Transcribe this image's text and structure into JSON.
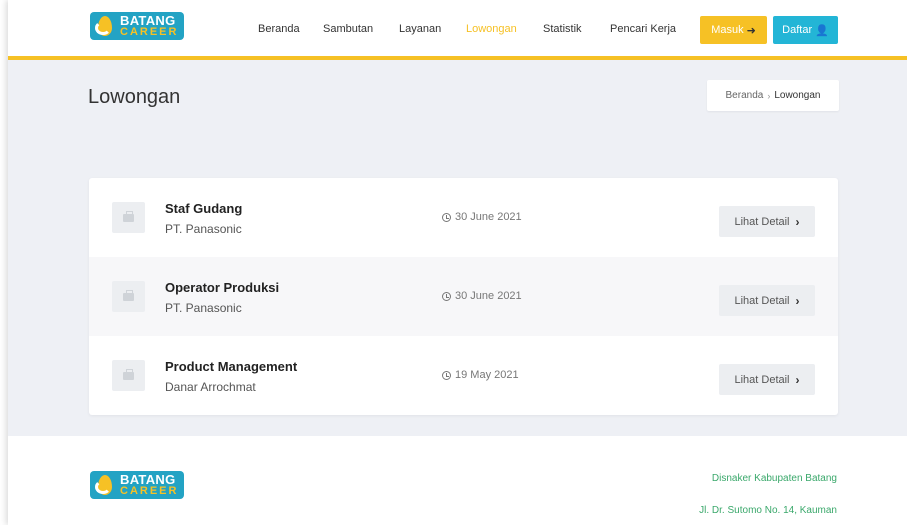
{
  "header": {
    "logo": {
      "line1": "BATANG",
      "line2": "CAREER"
    },
    "nav": [
      "Beranda",
      "Sambutan",
      "Layanan",
      "Lowongan",
      "Statistik",
      "Pencari Kerja"
    ],
    "active_nav": "Lowongan",
    "login_label": "Masuk",
    "register_label": "Daftar"
  },
  "page": {
    "title": "Lowongan",
    "breadcrumb": {
      "home": "Beranda",
      "separator": "›",
      "current": "Lowongan"
    }
  },
  "jobs": [
    {
      "title": "Staf Gudang",
      "company": "PT. Panasonic",
      "date": "30 June 2021",
      "action": "Lihat Detail"
    },
    {
      "title": "Operator Produksi",
      "company": "PT. Panasonic",
      "date": "30 June 2021",
      "action": "Lihat Detail"
    },
    {
      "title": "Product Management",
      "company": "Danar Arrochmat",
      "date": "19 May 2021",
      "action": "Lihat Detail"
    }
  ],
  "footer": {
    "logo": {
      "line1": "BATANG",
      "line2": "CAREER"
    },
    "org": "Disnaker Kabupaten Batang",
    "address": "Jl. Dr. Sutomo No. 14, Kauman"
  },
  "colors": {
    "accent": "#f6c125",
    "brand": "#23a3c4",
    "register": "#23b5d6",
    "footer_text": "#3aa86b"
  }
}
